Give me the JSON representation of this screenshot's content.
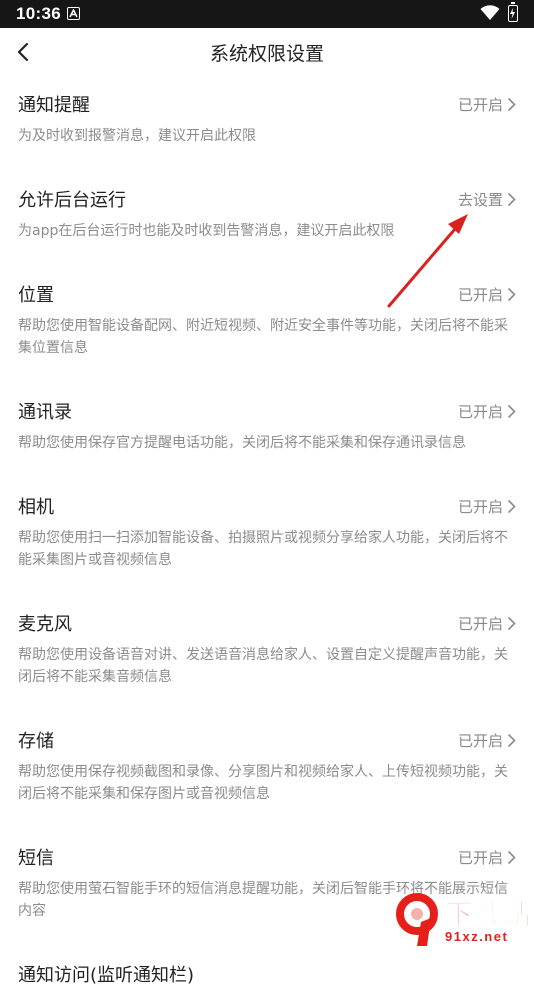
{
  "status_bar": {
    "time": "10:36",
    "notification_icon": "a-app-notification-icon",
    "wifi_icon": "wifi-icon",
    "battery_icon": "battery-charging-icon"
  },
  "header": {
    "back_icon": "chevron-left-icon",
    "title": "系统权限设置"
  },
  "permissions": [
    {
      "title": "通知提醒",
      "status": "已开启",
      "desc": "为及时收到报警消息，建议开启此权限"
    },
    {
      "title": "允许后台运行",
      "status": "去设置",
      "desc": "为app在后台运行时也能及时收到告警消息，建议开启此权限"
    },
    {
      "title": "位置",
      "status": "已开启",
      "desc": "帮助您使用智能设备配网、附近短视频、附近安全事件等功能，关闭后将不能采集位置信息"
    },
    {
      "title": "通讯录",
      "status": "已开启",
      "desc": "帮助您使用保存官方提醒电话功能，关闭后将不能采集和保存通讯录信息"
    },
    {
      "title": "相机",
      "status": "已开启",
      "desc": "帮助您使用扫一扫添加智能设备、拍摄照片或视频分享给家人功能，关闭后将不能采集图片或音视频信息"
    },
    {
      "title": "麦克风",
      "status": "已开启",
      "desc": "帮助您使用设备语音对讲、发送语音消息给家人、设置自定义提醒声音功能，关闭后将不能采集音频信息"
    },
    {
      "title": "存储",
      "status": "已开启",
      "desc": "帮助您使用保存视频截图和录像、分享图片和视频给家人、上传短视频功能，关闭后将不能采集和保存图片或音视频信息"
    },
    {
      "title": "短信",
      "status": "已开启",
      "desc": "帮助您使用萤石智能手环的短信消息提醒功能，关闭后智能手环将不能展示短信内容"
    },
    {
      "title": "通知访问(监听通知栏)",
      "status": "",
      "desc": ""
    }
  ],
  "watermark": {
    "logo": "9-download-site-logo",
    "text": "下载站",
    "url": "91xz.net"
  },
  "colors": {
    "status_bar_bg": "#161616",
    "annotation_arrow": "#d9221e",
    "watermark_red": "#e61f19"
  }
}
